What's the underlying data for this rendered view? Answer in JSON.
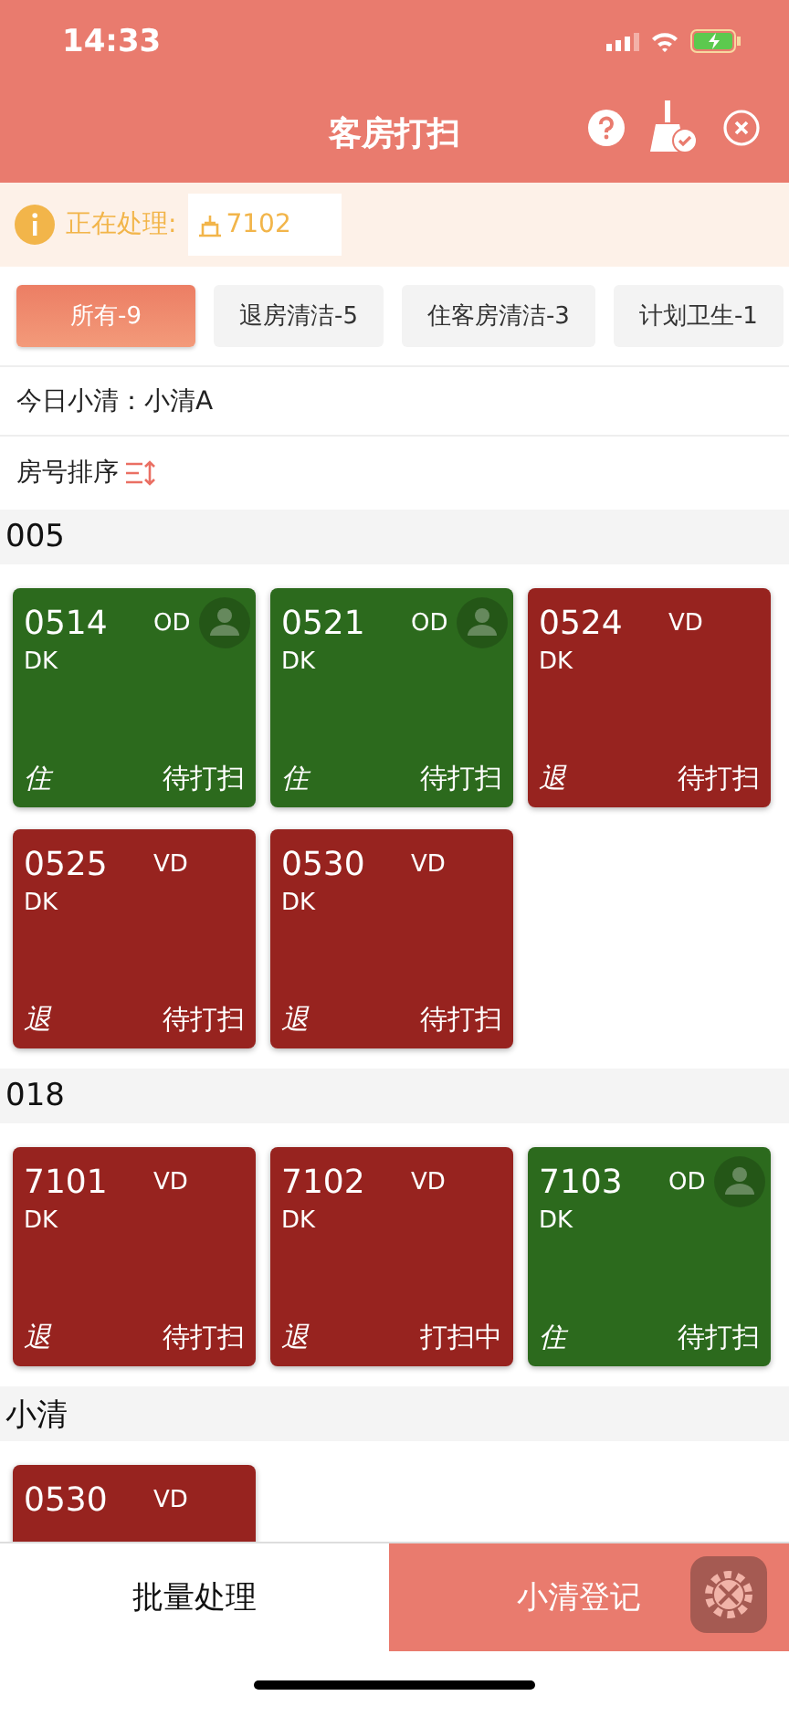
{
  "status_bar": {
    "time": "14:33"
  },
  "header": {
    "title": "客房打扫"
  },
  "processing": {
    "label": "正在处理:",
    "value": "7102"
  },
  "tabs": [
    {
      "label": "所有-9",
      "selected": true
    },
    {
      "label": "退房清洁-5",
      "selected": false
    },
    {
      "label": "住客房清洁-3",
      "selected": false
    },
    {
      "label": "计划卫生-1",
      "selected": false
    }
  ],
  "today_cleaner": "今日小清：小清A",
  "sort_label": "房号排序",
  "groups": [
    {
      "name": "005",
      "rooms": [
        {
          "number": "0514",
          "status": "OD",
          "type": "DK",
          "color": "#2c6a1d",
          "guest": true,
          "tag": "住",
          "state": "待打扫"
        },
        {
          "number": "0521",
          "status": "OD",
          "type": "DK",
          "color": "#2c6a1d",
          "guest": true,
          "tag": "住",
          "state": "待打扫"
        },
        {
          "number": "0524",
          "status": "VD",
          "type": "DK",
          "color": "#97231f",
          "guest": false,
          "tag": "退",
          "state": "待打扫"
        },
        {
          "number": "0525",
          "status": "VD",
          "type": "DK",
          "color": "#97231f",
          "guest": false,
          "tag": "退",
          "state": "待打扫"
        },
        {
          "number": "0530",
          "status": "VD",
          "type": "DK",
          "color": "#97231f",
          "guest": false,
          "tag": "退",
          "state": "待打扫"
        }
      ]
    },
    {
      "name": "018",
      "rooms": [
        {
          "number": "7101",
          "status": "VD",
          "type": "DK",
          "color": "#97231f",
          "guest": false,
          "tag": "退",
          "state": "待打扫"
        },
        {
          "number": "7102",
          "status": "VD",
          "type": "DK",
          "color": "#97231f",
          "guest": false,
          "tag": "退",
          "state": "打扫中"
        },
        {
          "number": "7103",
          "status": "OD",
          "type": "DK",
          "color": "#2c6a1d",
          "guest": true,
          "tag": "住",
          "state": "待打扫"
        }
      ]
    },
    {
      "name": "小清",
      "rooms": [
        {
          "number": "0530",
          "status": "VD",
          "color": "#97231f",
          "guest": false
        }
      ]
    }
  ],
  "bottom": {
    "batch": "批量处理",
    "register": "小清登记"
  }
}
